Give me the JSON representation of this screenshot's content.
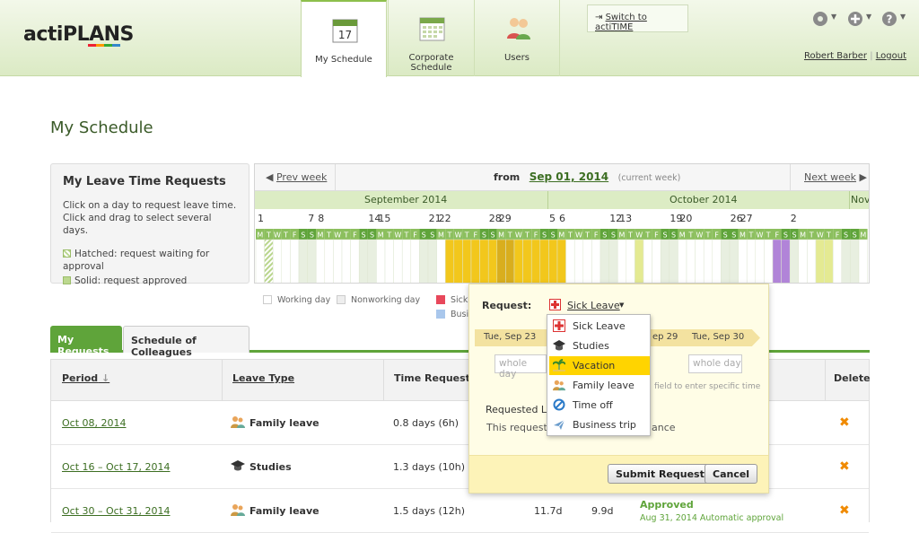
{
  "header": {
    "logo_text": "actiPLANS",
    "tabs": [
      {
        "label": "My Schedule",
        "active": true,
        "icon": "calendar-17-icon",
        "icon_text": "17"
      },
      {
        "label": "Corporate Schedule",
        "active": false,
        "icon": "calendar-grid-icon"
      },
      {
        "label": "Users",
        "active": false,
        "icon": "users-icon"
      }
    ],
    "switch_link": "Switch to actiTIME",
    "icons": [
      "gear-icon",
      "add-icon",
      "help-icon"
    ],
    "user_name": "Robert Barber",
    "logout": "Logout"
  },
  "page_title": "My Schedule",
  "info_panel": {
    "title": "My Leave Time Requests",
    "line1": "Click on a day to request leave time.",
    "line2": "Click and drag to select several days.",
    "legend_hatched": "Hatched: request waiting for approval",
    "legend_solid": "Solid: request approved"
  },
  "calendar": {
    "prev": "Prev week",
    "next": "Next week",
    "from_label": "from",
    "from_date": "Sep 01, 2014",
    "current_week": "(current week)",
    "months": [
      "September 2014",
      "October 2014",
      "Nov"
    ],
    "day_numbers": [
      "1",
      "7",
      "8",
      "14",
      "15",
      "21",
      "22",
      "28",
      "29",
      "5",
      "6",
      "12",
      "13",
      "19",
      "20",
      "26",
      "27",
      "2"
    ],
    "day_letters": [
      "M",
      "T",
      "W",
      "T",
      "F",
      "S",
      "S"
    ]
  },
  "legend": {
    "working": "Working day",
    "nonworking": "Nonworking day",
    "sick": "Sick",
    "business": "Busi"
  },
  "tabs": {
    "my_requests": "My Requests",
    "colleagues": "Schedule of Colleagues"
  },
  "table": {
    "headers": {
      "period": "Period",
      "leave_type": "Leave Type",
      "time_requested": "Time Requested",
      "delete": "Delete"
    },
    "rows": [
      {
        "period": "Oct 08, 2014",
        "type": "Family leave",
        "time": "0.8 days (6h)",
        "icon": "family-icon"
      },
      {
        "period": "Oct 16 – Oct 17, 2014",
        "type": "Studies",
        "time": "1.3 days (10h)",
        "icon": "graduation-cap-icon"
      },
      {
        "period": "Oct 30 – Oct 31, 2014",
        "type": "Family leave",
        "time": "1.5 days (12h)",
        "icon": "family-icon",
        "col_a": "11.7d",
        "col_b": "9.9d",
        "status": "Approved",
        "status_note": "Aug 31, 2014 Automatic approval"
      }
    ]
  },
  "popup": {
    "request_label": "Request:",
    "selected_type": "Sick Leave",
    "date_start": "Tue, Sep 23",
    "date_mid_fragment": "ep 29",
    "date_end": "Tue, Sep 30",
    "placeholder": "whole day",
    "hint_fragment": "field to enter specific time",
    "requested_fragment": "Requested Le",
    "this_request_fragment": "This request",
    "balance_fragment": "ance",
    "submit": "Submit Request",
    "cancel": "Cancel"
  },
  "dropdown": {
    "items": [
      {
        "label": "Sick Leave",
        "icon": "red-cross-icon",
        "selected": false
      },
      {
        "label": "Studies",
        "icon": "graduation-cap-icon",
        "selected": false
      },
      {
        "label": "Vacation",
        "icon": "palm-tree-icon",
        "selected": true
      },
      {
        "label": "Family leave",
        "icon": "family-icon",
        "selected": false
      },
      {
        "label": "Time off",
        "icon": "no-entry-icon",
        "selected": false
      },
      {
        "label": "Business trip",
        "icon": "airplane-icon",
        "selected": false
      }
    ]
  },
  "colors": {
    "accent": "#5fa43a",
    "link": "#3c6e22",
    "selected": "#ffd400",
    "sick": "#e8485b",
    "business": "#a9c7ec",
    "studies": "#b184d8",
    "family": "#e4ea92"
  }
}
